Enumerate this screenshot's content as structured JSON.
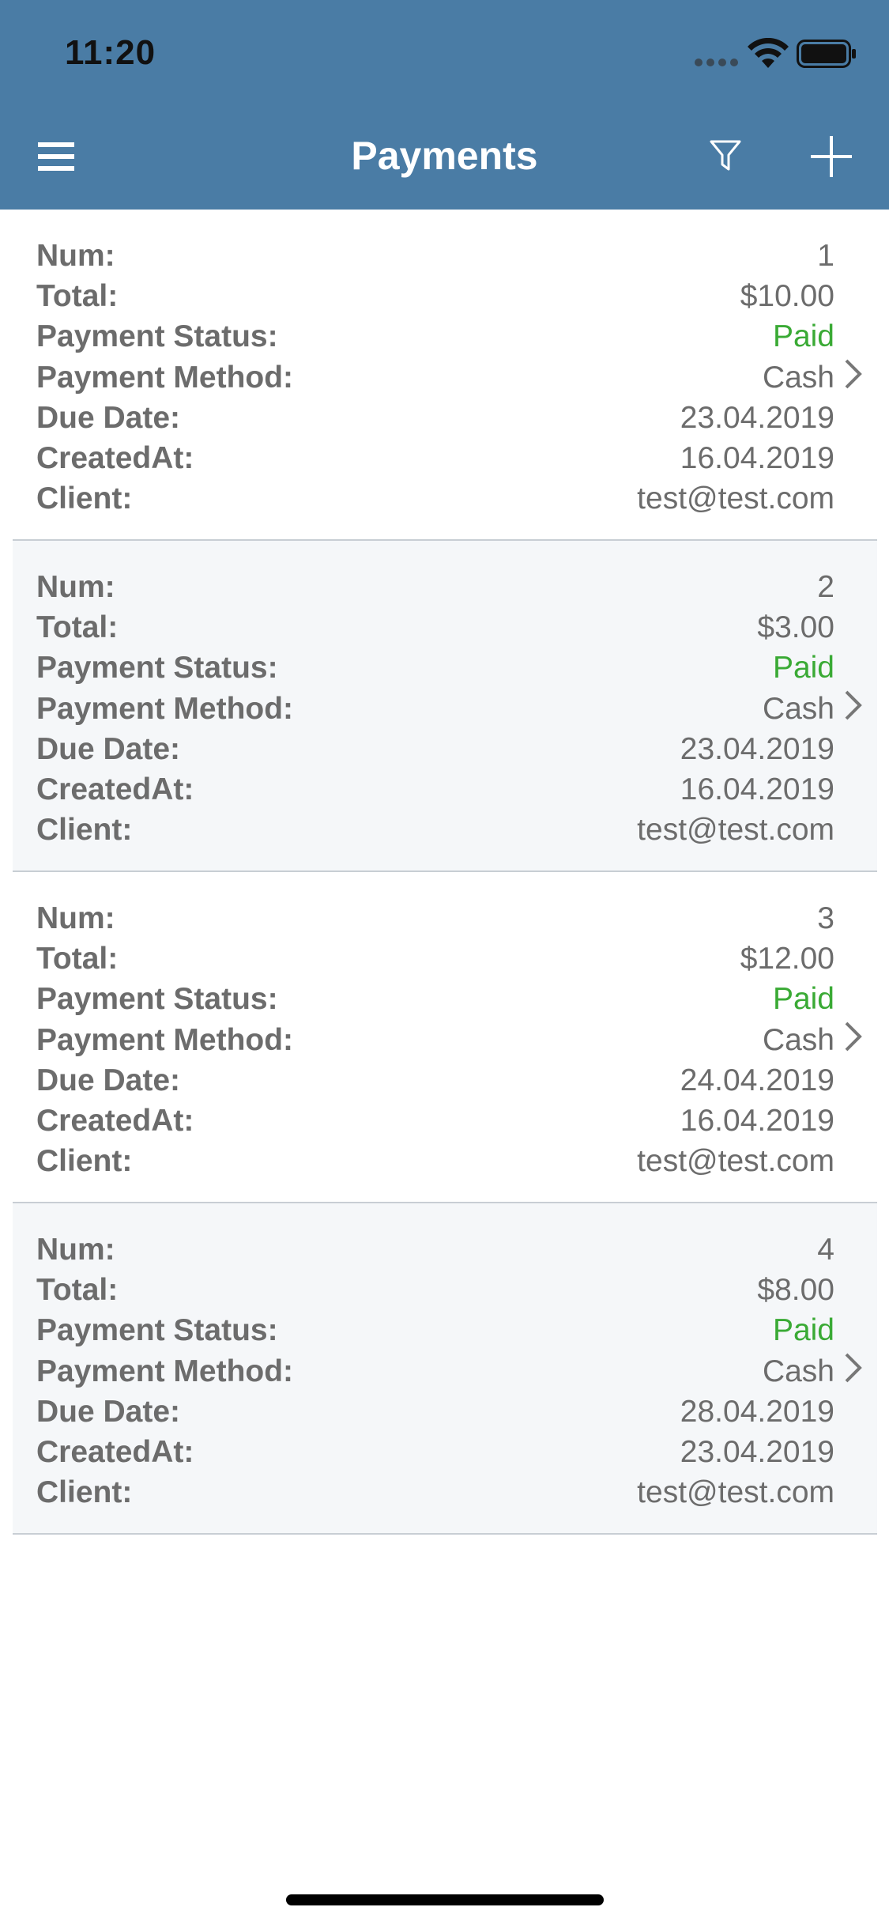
{
  "status_bar": {
    "time": "11:20"
  },
  "nav": {
    "title": "Payments",
    "icons": {
      "menu": "hamburger-menu-icon",
      "filter": "filter-icon",
      "add": "plus-icon"
    }
  },
  "labels": {
    "num": "Num:",
    "total": "Total:",
    "status": "Payment Status:",
    "method": "Payment Method:",
    "due": "Due Date:",
    "created": "CreatedAt:",
    "client": "Client:"
  },
  "colors": {
    "header": "#4a7ca5",
    "paid": "#3aaa35",
    "text": "#6c6c6c"
  },
  "payments": [
    {
      "num": "1",
      "total": "$10.00",
      "status": "Paid",
      "method": "Cash",
      "due": "23.04.2019",
      "created": "16.04.2019",
      "client": "test@test.com"
    },
    {
      "num": "2",
      "total": "$3.00",
      "status": "Paid",
      "method": "Cash",
      "due": "23.04.2019",
      "created": "16.04.2019",
      "client": "test@test.com"
    },
    {
      "num": "3",
      "total": "$12.00",
      "status": "Paid",
      "method": "Cash",
      "due": "24.04.2019",
      "created": "16.04.2019",
      "client": "test@test.com"
    },
    {
      "num": "4",
      "total": "$8.00",
      "status": "Paid",
      "method": "Cash",
      "due": "28.04.2019",
      "created": "23.04.2019",
      "client": "test@test.com"
    }
  ]
}
